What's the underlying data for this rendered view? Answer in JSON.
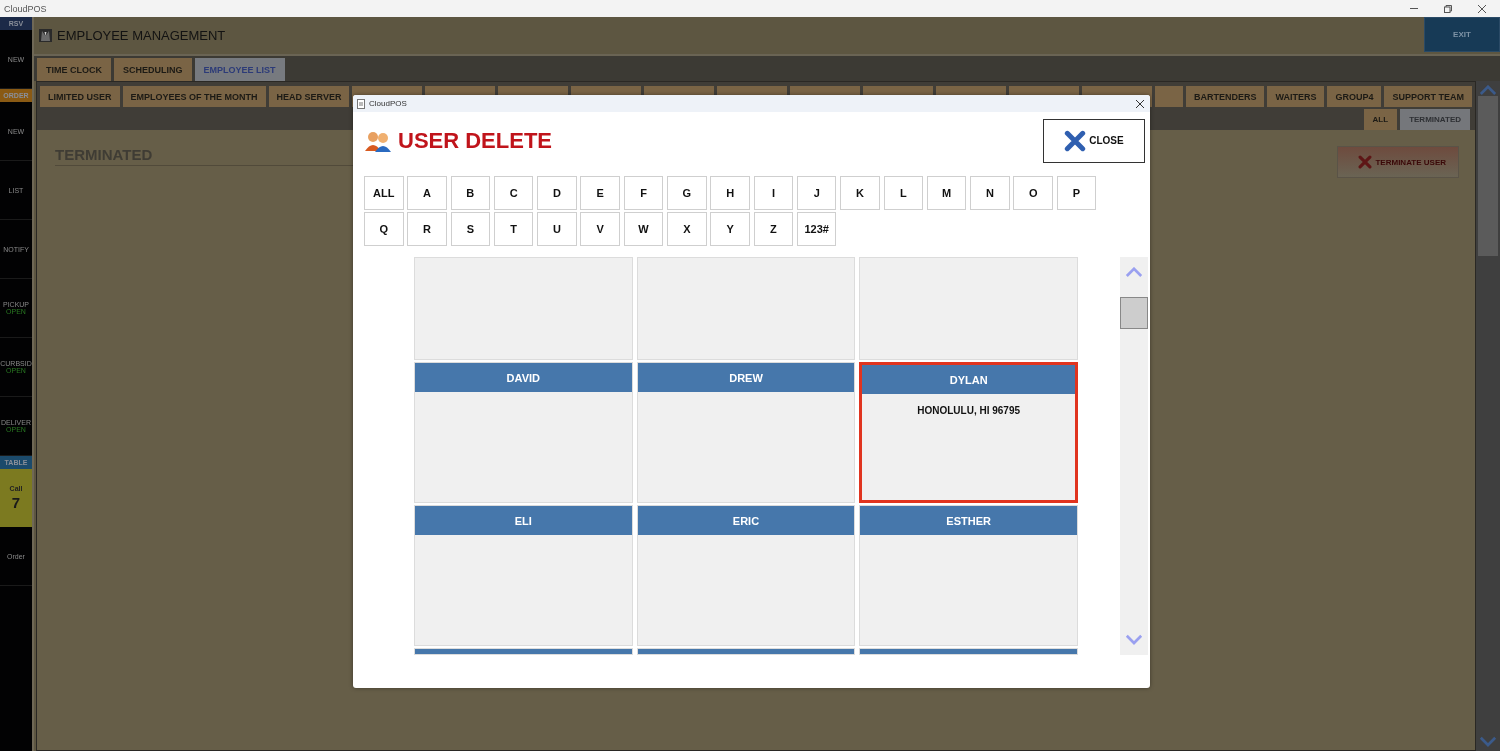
{
  "window": {
    "title": "CloudPOS"
  },
  "sidebar": {
    "items": [
      {
        "kind": "header",
        "label": "RSV",
        "color": "#1c2a48"
      },
      {
        "kind": "button",
        "label": "NEW"
      },
      {
        "kind": "header",
        "label": "ORDER",
        "color": "#8a5a14"
      },
      {
        "kind": "button",
        "label": "NEW"
      },
      {
        "kind": "button",
        "label": "LIST"
      },
      {
        "kind": "button",
        "label": "NOTIFY"
      },
      {
        "kind": "status",
        "label": "PICKUP",
        "status": "OPEN"
      },
      {
        "kind": "status",
        "label": "CURBSID",
        "status": "OPEN"
      },
      {
        "kind": "status",
        "label": "DELIVER",
        "status": "OPEN"
      },
      {
        "kind": "header",
        "label": "TABLE",
        "color": "#1b4a6b"
      },
      {
        "kind": "highlight",
        "label": "Call",
        "value": "7"
      },
      {
        "kind": "button",
        "label": "Order"
      }
    ]
  },
  "header": {
    "title": "EMPLOYEE MANAGEMENT",
    "exit": "EXIT"
  },
  "tabs": [
    {
      "label": "TIME CLOCK",
      "selected": false
    },
    {
      "label": "SCHEDULING",
      "selected": false
    },
    {
      "label": "EMPLOYEE LIST",
      "selected": true
    }
  ],
  "groups_left": [
    "LIMITED USER",
    "EMPLOYEES OF THE MONTH",
    "HEAD SERVER"
  ],
  "groups_right": [
    "BARTENDERS",
    "WAITERS",
    "GROUP4",
    "SUPPORT TEAM"
  ],
  "filters": [
    {
      "label": "ALL",
      "selected": false
    },
    {
      "label": "TERMINATED",
      "selected": true
    }
  ],
  "content": {
    "heading": "TERMINATED",
    "action": "TERMINATE USER"
  },
  "dialog": {
    "window_title": "CloudPOS",
    "title": "USER DELETE",
    "close": "CLOSE",
    "letters": [
      "ALL",
      "A",
      "B",
      "C",
      "D",
      "E",
      "F",
      "G",
      "H",
      "I",
      "J",
      "K",
      "L",
      "M",
      "N",
      "O",
      "P",
      "Q",
      "R",
      "S",
      "T",
      "U",
      "V",
      "W",
      "X",
      "Y",
      "Z",
      "123#"
    ],
    "cards": [
      {
        "kind": "partial-top",
        "selected": false
      },
      {
        "kind": "partial-top",
        "selected": false
      },
      {
        "kind": "partial-top",
        "selected": false
      },
      {
        "kind": "full",
        "name": "DAVID",
        "selected": false
      },
      {
        "kind": "full",
        "name": "DREW",
        "selected": false
      },
      {
        "kind": "full",
        "name": "DYLAN",
        "address": "HONOLULU, HI 96795",
        "selected": true
      },
      {
        "kind": "full",
        "name": "ELI",
        "selected": false
      },
      {
        "kind": "full",
        "name": "ERIC",
        "selected": false
      },
      {
        "kind": "full",
        "name": "ESTHER",
        "selected": false
      },
      {
        "kind": "partial-bottom",
        "selected": false
      },
      {
        "kind": "partial-bottom",
        "selected": false
      },
      {
        "kind": "partial-bottom",
        "selected": false
      }
    ]
  }
}
